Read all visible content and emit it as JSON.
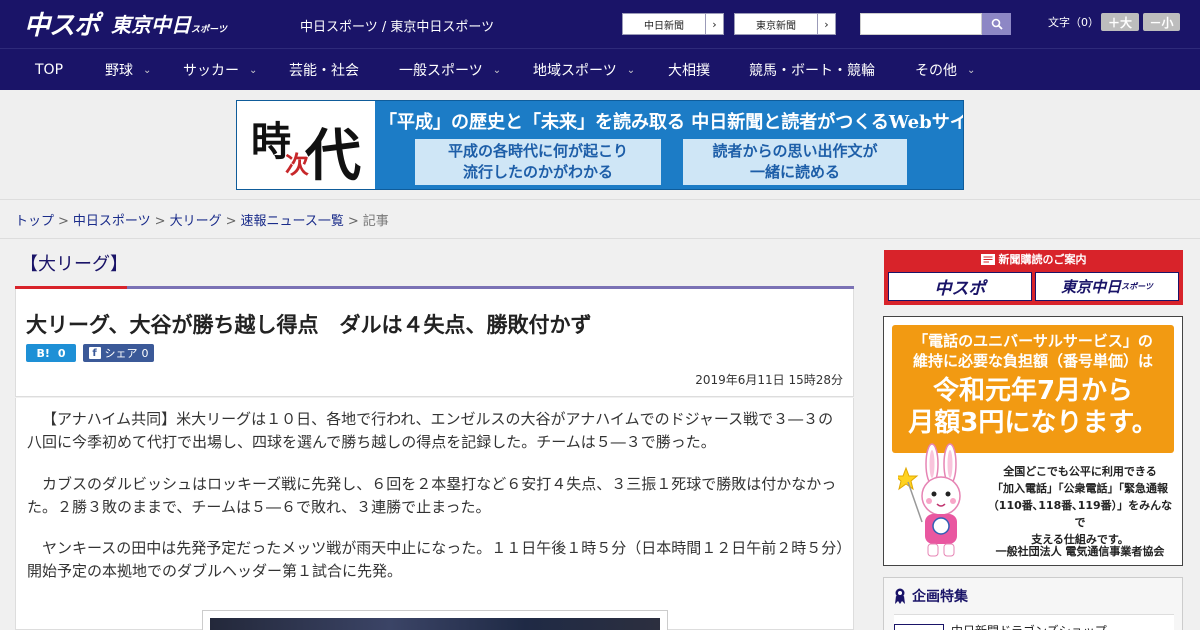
{
  "header": {
    "logo_chuspo": "中スポ",
    "logo_tokyo": "東京中日",
    "logo_tokyo_sub": "スポーツ",
    "site_links": "中日スポーツ / 東京中日スポーツ",
    "paper_buttons": [
      {
        "label": "中日新聞",
        "arrow": "›"
      },
      {
        "label": "東京新聞",
        "arrow": "›"
      }
    ],
    "search_placeholder": "",
    "font_size_label": "文字（0）",
    "font_larger": "＋大",
    "font_smaller": "－小"
  },
  "nav": [
    {
      "label": "TOP",
      "has_menu": false
    },
    {
      "label": "野球",
      "has_menu": true
    },
    {
      "label": "サッカー",
      "has_menu": true
    },
    {
      "label": "芸能・社会",
      "has_menu": false
    },
    {
      "label": "一般スポーツ",
      "has_menu": true
    },
    {
      "label": "地域スポーツ",
      "has_menu": true
    },
    {
      "label": "大相撲",
      "has_menu": false
    },
    {
      "label": "競馬・ボート・競輪",
      "has_menu": false
    },
    {
      "label": "その他",
      "has_menu": true
    }
  ],
  "banner": {
    "logo_k1": "時",
    "logo_k2": "次",
    "logo_k3": "代",
    "headline": "「平成」の歴史と「未来」を読み取る 中日新聞と読者がつくるWebサイト",
    "box_left": [
      "平成の各時代に何が起こり",
      "流行したのかがわかる"
    ],
    "box_right": [
      "読者からの思い出作文が",
      "一緒に読める"
    ]
  },
  "breadcrumb": {
    "items": [
      "トップ",
      "中日スポーツ",
      "大リーグ",
      "速報ニュース一覧"
    ],
    "current": "記事",
    "separator": ">"
  },
  "article": {
    "category": "【大リーグ】",
    "title": "大リーグ、大谷が勝ち越し得点　ダルは４失点、勝敗付かず",
    "hatena_label": "B!",
    "hatena_count": "0",
    "fb_icon": "f",
    "fb_label": "シェア",
    "fb_count": "0",
    "date": "2019年6月11日 15時28分",
    "paragraphs": [
      "【アナハイム共同】米大リーグは１０日、各地で行われ、エンゼルスの大谷がアナハイムでのドジャース戦で３―３の八回に今季初めて代打で出場し、四球を選んで勝ち越しの得点を記録した。チームは５―３で勝った。",
      "カブスのダルビッシュはロッキーズ戦に先発し、６回を２本塁打など６安打４失点、３三振１死球で勝敗は付かなかった。２勝３敗のままで、チームは５―６で敗れ、３連勝で止まった。",
      "ヤンキースの田中は先発予定だったメッツ戦が雨天中止になった。１１日午後１時５分（日本時間１２日午前２時５分）開始予定の本拠地でのダブルヘッダー第１試合に先発。"
    ]
  },
  "sidebar": {
    "subscribe_header": "新聞購読のご案内",
    "subscribe_logos": [
      "中スポ",
      "東京中日"
    ],
    "subscribe_tokyo_sub": "スポーツ",
    "ad_question": [
      "「電話のユニバーサルサービス」の",
      "維持に必要な負担額（番号単価）は"
    ],
    "ad_big": [
      "令和元年7月から",
      "月額3円になります。"
    ],
    "ad_small": [
      "全国どこでも公平に利用できる",
      "「加入電話」「公衆電話」「緊急通報",
      "（110番､118番､119番）」をみんなで",
      "支える仕組みです。"
    ],
    "ad_org": "一般社団法人 電気通信事業者協会",
    "feature_title": "企画特集",
    "feature_item": "中日新聞ドラゴンズショップ"
  },
  "colors": {
    "brand_navy": "#1a1468",
    "accent_red": "#d8232a",
    "accent_purple": "#7b72b5",
    "ad_orange": "#f29a12"
  }
}
